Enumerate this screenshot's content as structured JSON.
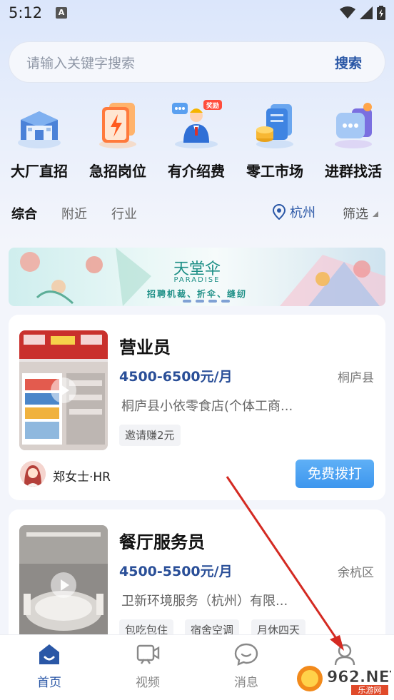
{
  "status_bar": {
    "time": "5:12",
    "notification_letter": "A"
  },
  "search": {
    "placeholder": "请输入关键字搜索",
    "button_label": "搜索"
  },
  "categories": [
    {
      "label": "大厂直招",
      "icon": "factory-building-icon"
    },
    {
      "label": "急招岗位",
      "icon": "urgent-lightning-icon"
    },
    {
      "label": "有介绍费",
      "icon": "referral-person-icon",
      "badge": "奖励"
    },
    {
      "label": "零工市场",
      "icon": "gig-coins-icon"
    },
    {
      "label": "进群找活",
      "icon": "group-chat-icon"
    }
  ],
  "filters": {
    "tabs": [
      "综合",
      "附近",
      "行业"
    ],
    "active_tab": "综合",
    "location": "杭州",
    "filter_label": "筛选"
  },
  "banner": {
    "title": "天堂伞",
    "subtitle_en": "PARADISE",
    "subtitle": "招聘机裁、折伞、缝纫",
    "active_dot": 0,
    "dot_count": 4
  },
  "jobs": [
    {
      "title": "营业员",
      "salary": "4500-6500元/月",
      "region": "桐庐县",
      "company": "桐庐县小依零食店(个体工商...",
      "tags": [
        "邀请赚2元"
      ],
      "hr_name": "郑女士·HR",
      "call_label": "免费拨打"
    },
    {
      "title": "餐厅服务员",
      "salary": "4500-5500元/月",
      "region": "余杭区",
      "company": "卫新环境服务（杭州）有限...",
      "tags": [
        "包吃包住",
        "宿舍空调",
        "月休四天"
      ]
    }
  ],
  "bottom_nav": [
    {
      "label": "首页",
      "icon": "home-icon",
      "active": true
    },
    {
      "label": "视频",
      "icon": "video-icon",
      "active": false
    },
    {
      "label": "消息",
      "icon": "message-icon",
      "active": false
    },
    {
      "label": "",
      "icon": "profile-icon",
      "active": false
    }
  ],
  "watermark": {
    "brand": "962.NET",
    "site": "乐游网"
  },
  "colors": {
    "accent": "#2a57a6",
    "call_button": "#4aa0f0",
    "background": "#f3f5fb"
  }
}
